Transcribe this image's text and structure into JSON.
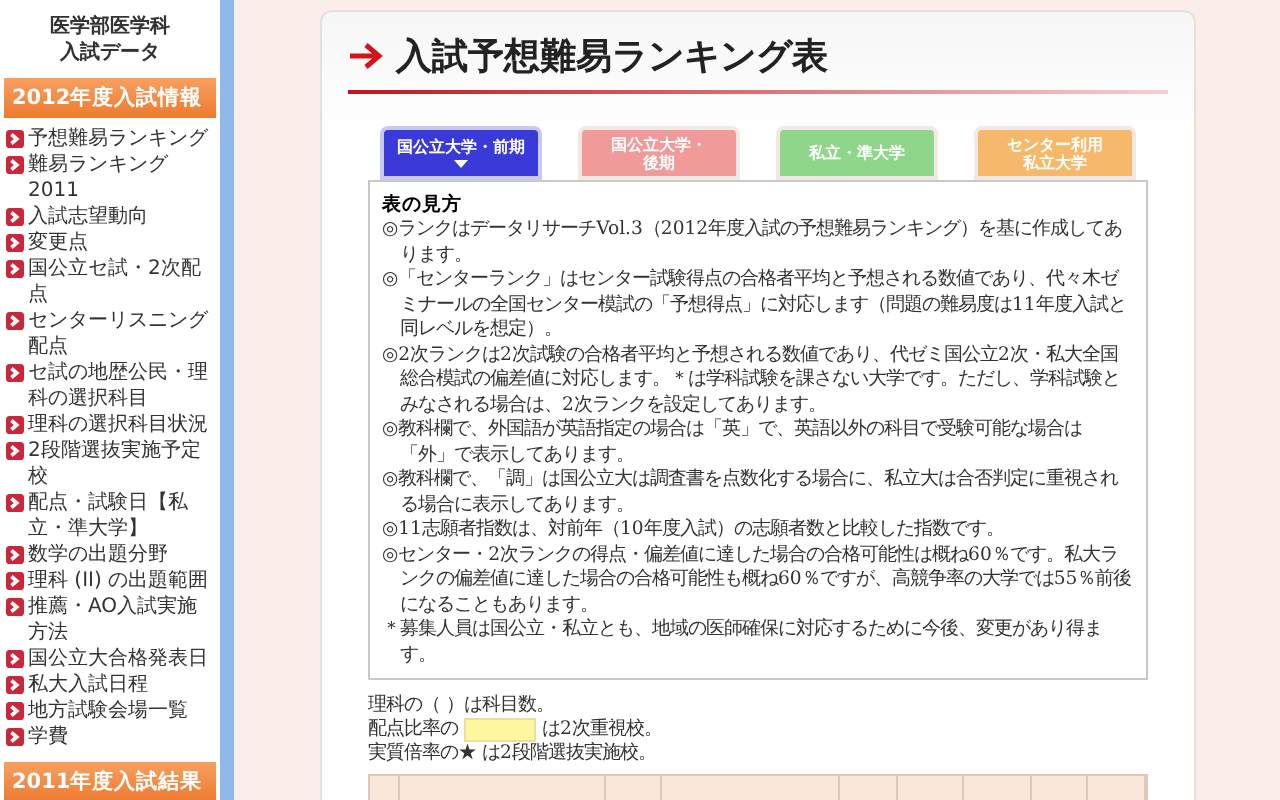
{
  "sidebar": {
    "heading_lines": [
      "医学部医学科",
      "入試データ"
    ],
    "sections": [
      {
        "title": "2012年度入試情報",
        "items": [
          "予想難易ランキング",
          "難易ランキング2011",
          "入試志望動向",
          "変更点",
          "国公立セ試・2次配点",
          "センターリスニング配点",
          "セ試の地歴公民・理科の選択科目",
          "理科の選択科目状況",
          "2段階選抜実施予定校",
          "配点・試験日【私立・準大学】",
          "数学の出題分野",
          "理科 (II) の出題範囲",
          "推薦・AO入試実施方法",
          "国公立大合格発表日",
          "私大入試日程",
          "地方試験会場一覧",
          "学費"
        ]
      },
      {
        "title": "2011年度入試結果"
      }
    ]
  },
  "main": {
    "title": "入試予想難易ランキング表",
    "tabs": [
      {
        "label": "国公立大学・前期",
        "selected": true,
        "color": "#3a3ad8"
      },
      {
        "label": "国公立大学・後期",
        "selected": false,
        "color": "#f09a9a"
      },
      {
        "label": "私立・準大学",
        "selected": false,
        "color": "#8fd68a"
      },
      {
        "label": "センター利用私立大学",
        "selected": false,
        "color": "#f6b86a"
      }
    ],
    "notes": {
      "title": "表の見方",
      "items": [
        "◎ランクはデータリサーチVol.3（2012年度入試の予想難易ランキング）を基に作成してあります。",
        "◎「センターランク」はセンター試験得点の合格者平均と予想される数値であり、代々木ゼミナールの全国センター模試の「予想得点」に対応します（問題の難易度は11年度入試と同レベルを想定）。",
        "◎2次ランクは2次試験の合格者平均と予想される数値であり、代ゼミ国公立2次・私大全国総合模試の偏差値に対応します。＊は学科試験を課さない大学です。ただし、学科試験とみなされる場合は、2次ランクを設定してあります。",
        "◎教科欄で、外国語が英語指定の場合は「英」で、英語以外の科目で受験可能な場合は「外」で表示してあります。",
        "◎教科欄で、「調」は国公立大は調査書を点数化する場合に、私立大は合否判定に重視される場合に表示してあります。",
        "◎11志願者指数は、対前年（10年度入試）の志願者数と比較した指数です。",
        "◎センター・2次ランクの得点・偏差値に達した場合の合格可能性は概ね60％です。私大ランクの偏差値に達した場合の合格可能性も概ね60％ですが、高競争率の大学では55％前後になることもあります。",
        "＊募集人員は国公立・私立とも、地域の医師確保に対応するために今後、変更があり得ます。"
      ]
    },
    "legend": [
      {
        "kind": "text",
        "text": "理科の（ ）は科目数。"
      },
      {
        "kind": "swatch",
        "before": "配点比率の",
        "color": "#fff6a0",
        "after": "は2次重視校。"
      },
      {
        "kind": "text",
        "text": "実質倍率の★ は2段階選抜実施校。"
      }
    ]
  }
}
